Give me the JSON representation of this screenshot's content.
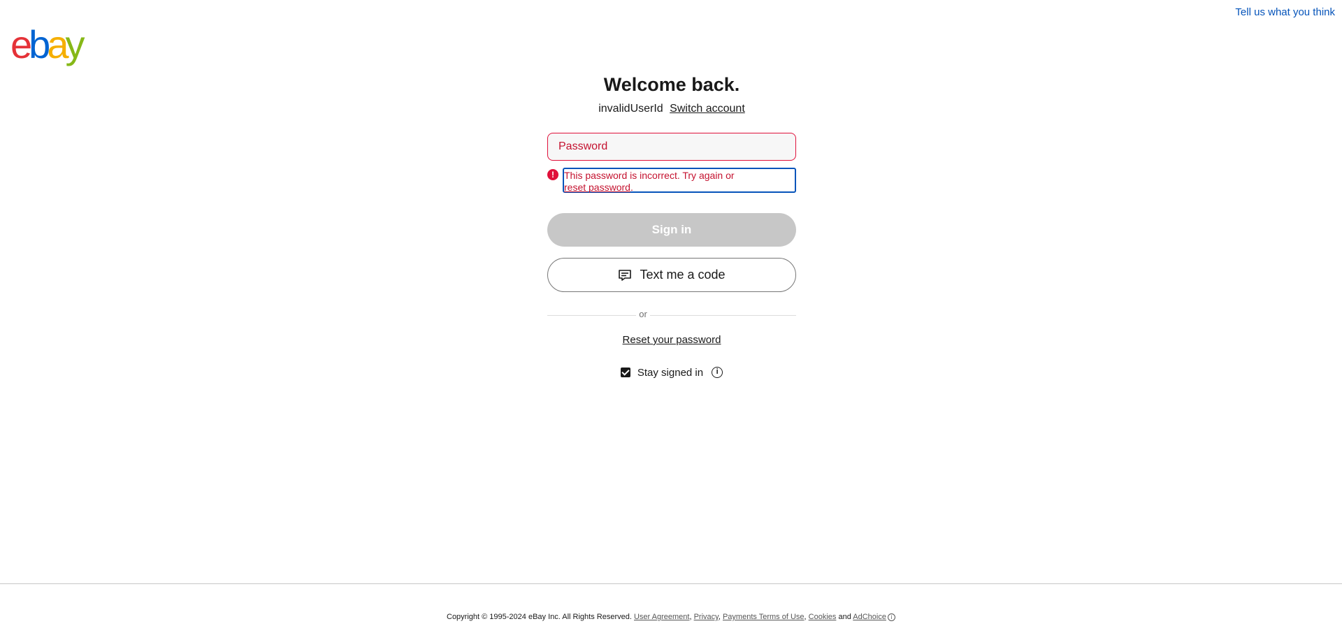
{
  "header": {
    "feedback_link": "Tell us what you think"
  },
  "logo": {
    "text": "ebay",
    "letters": [
      "e",
      "b",
      "a",
      "y"
    ],
    "colors": [
      "#e53238",
      "#0064d2",
      "#f5af02",
      "#86b817"
    ]
  },
  "main": {
    "title": "Welcome back.",
    "user_id": "invalidUserId",
    "switch_account": "Switch account",
    "password_placeholder": "Password",
    "error": {
      "text": "This password is incorrect. Try again or",
      "link": "reset password",
      "suffix": ".",
      "icon": "alert-icon"
    },
    "sign_in_label": "Sign in",
    "text_code_label": "Text me a code",
    "divider_text": "or",
    "reset_password": "Reset your password",
    "stay_signed_in": "Stay signed in",
    "stay_signed_in_checked": true
  },
  "footer": {
    "copyright": "Copyright © 1995-2024 eBay Inc. All Rights Reserved.",
    "links": [
      "User Agreement",
      "Privacy",
      "Payments Terms of Use",
      "Cookies"
    ],
    "and": "and",
    "adchoice": "AdChoice"
  },
  "colors": {
    "error": "#e0103a",
    "link_blue": "#0654ba",
    "disabled_button": "#c7c7c7"
  }
}
